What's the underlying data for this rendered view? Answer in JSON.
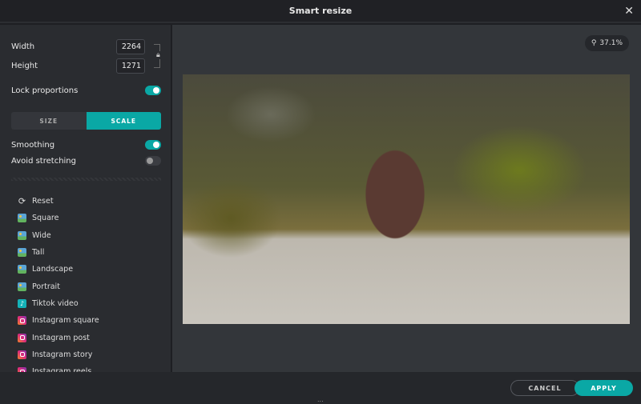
{
  "window": {
    "title": "Smart resize"
  },
  "size": {
    "width_label": "Width",
    "width_value": "2264",
    "height_label": "Height",
    "height_value": "1271"
  },
  "lock_proportions": {
    "label": "Lock proportions",
    "on": true
  },
  "mode": {
    "options": [
      "SIZE",
      "SCALE"
    ],
    "selected": "SCALE"
  },
  "smoothing": {
    "label": "Smoothing",
    "on": true
  },
  "avoid_stretching": {
    "label": "Avoid stretching",
    "on": false
  },
  "presets": [
    {
      "label": "Reset",
      "icon": "reset-icon"
    },
    {
      "label": "Square",
      "icon": "image-icon"
    },
    {
      "label": "Wide",
      "icon": "image-icon"
    },
    {
      "label": "Tall",
      "icon": "image-icon"
    },
    {
      "label": "Landscape",
      "icon": "image-icon"
    },
    {
      "label": "Portrait",
      "icon": "image-icon"
    },
    {
      "label": "Tiktok video",
      "icon": "tiktok-icon"
    },
    {
      "label": "Instagram square",
      "icon": "instagram-icon"
    },
    {
      "label": "Instagram post",
      "icon": "instagram-icon"
    },
    {
      "label": "Instagram story",
      "icon": "instagram-icon"
    },
    {
      "label": "Instagram reels",
      "icon": "instagram-icon"
    }
  ],
  "zoom": {
    "value": "37.1%"
  },
  "footer": {
    "cancel": "CANCEL",
    "apply": "APPLY",
    "more": "..."
  },
  "colors": {
    "accent": "#0aa8a5"
  }
}
